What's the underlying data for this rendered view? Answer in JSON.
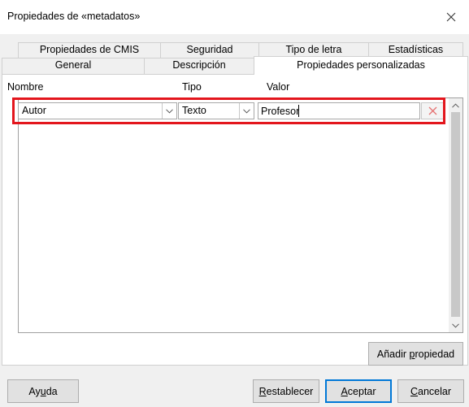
{
  "window": {
    "title": "Propiedades de «metadatos»",
    "close_glyph": "×"
  },
  "tabs_row1": [
    {
      "label": "Propiedades de CMIS"
    },
    {
      "label": "Seguridad"
    },
    {
      "label": "Tipo de letra"
    },
    {
      "label": "Estadísticas"
    }
  ],
  "tabs_row2": [
    {
      "label": "General"
    },
    {
      "label": "Descripción"
    },
    {
      "label": "Propiedades personalizadas",
      "active": true
    }
  ],
  "columns": {
    "name": "Nombre",
    "type": "Tipo",
    "value": "Valor"
  },
  "properties": [
    {
      "name": "Autor",
      "type": "Texto",
      "value": "Profesor"
    }
  ],
  "add_property": {
    "label_before": "Añadir ",
    "label_mnemonic": "p",
    "label_after": "ropiedad"
  },
  "footer": {
    "help": {
      "before": "Ay",
      "mnemonic": "u",
      "after": "da"
    },
    "reset": {
      "before": "",
      "mnemonic": "R",
      "after": "establecer"
    },
    "ok": {
      "before": "",
      "mnemonic": "A",
      "after": "ceptar"
    },
    "cancel": {
      "before": "",
      "mnemonic": "C",
      "after": "ancelar"
    }
  },
  "colors": {
    "highlight": "#e3161d",
    "default_button_border": "#0078d7",
    "remove_icon": "#e57373"
  }
}
